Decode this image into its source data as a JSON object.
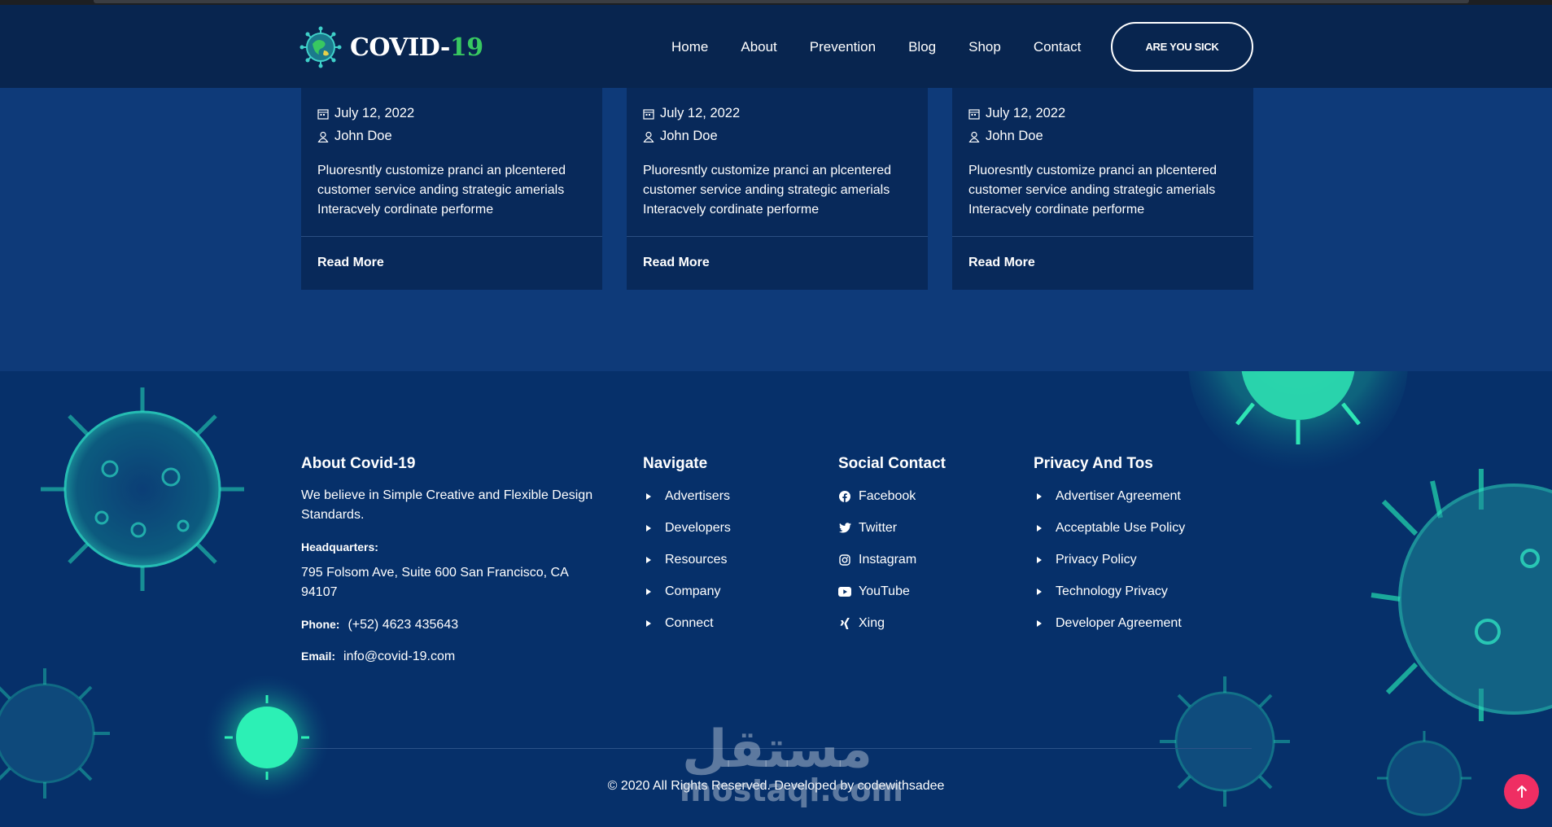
{
  "header": {
    "logo_main": "COVID-",
    "logo_num": "19",
    "nav": [
      "Home",
      "About",
      "Prevention",
      "Blog",
      "Shop",
      "Contact"
    ],
    "cta": "ARE YOU SICK"
  },
  "blog": {
    "cards": [
      {
        "date": "July 12, 2022",
        "author": "John Doe",
        "excerpt": "Pluoresntly customize pranci an plcentered customer service anding strategic amerials Interacvely cordinate performe",
        "read_more": "Read More"
      },
      {
        "date": "July 12, 2022",
        "author": "John Doe",
        "excerpt": "Pluoresntly customize pranci an plcentered customer service anding strategic amerials Interacvely cordinate performe",
        "read_more": "Read More"
      },
      {
        "date": "July 12, 2022",
        "author": "John Doe",
        "excerpt": "Pluoresntly customize pranci an plcentered customer service anding strategic amerials Interacvely cordinate performe",
        "read_more": "Read More"
      }
    ]
  },
  "footer": {
    "about": {
      "title": "About Covid-19",
      "text": "We believe in Simple Creative and Flexible Design Standards.",
      "hq_label": "Headquarters:",
      "address": "795 Folsom Ave, Suite 600 San Francisco, CA 94107",
      "phone_label": "Phone:",
      "phone": "(+52) 4623 435643",
      "email_label": "Email:",
      "email": "info@covid-19.com"
    },
    "navigate": {
      "title": "Navigate",
      "items": [
        "Advertisers",
        "Developers",
        "Resources",
        "Company",
        "Connect"
      ]
    },
    "social": {
      "title": "Social Contact",
      "items": [
        {
          "label": "Facebook",
          "icon": "facebook-icon"
        },
        {
          "label": "Twitter",
          "icon": "twitter-icon"
        },
        {
          "label": "Instagram",
          "icon": "instagram-icon"
        },
        {
          "label": "YouTube",
          "icon": "youtube-icon"
        },
        {
          "label": "Xing",
          "icon": "xing-icon"
        }
      ]
    },
    "privacy": {
      "title": "Privacy And Tos",
      "items": [
        "Advertiser Agreement",
        "Acceptable Use Policy",
        "Privacy Policy",
        "Technology Privacy",
        "Developer Agreement"
      ]
    },
    "copyright": "© 2020 All Rights Reserved. Developed by codewithsadee"
  },
  "watermark": {
    "arabic": "مستقل",
    "latin": "mostaql.com"
  },
  "colors": {
    "accent_green": "#38c861",
    "header_bg": "#08254f",
    "footer_bg": "#06306a",
    "scroll_top": "#ef2e63"
  }
}
